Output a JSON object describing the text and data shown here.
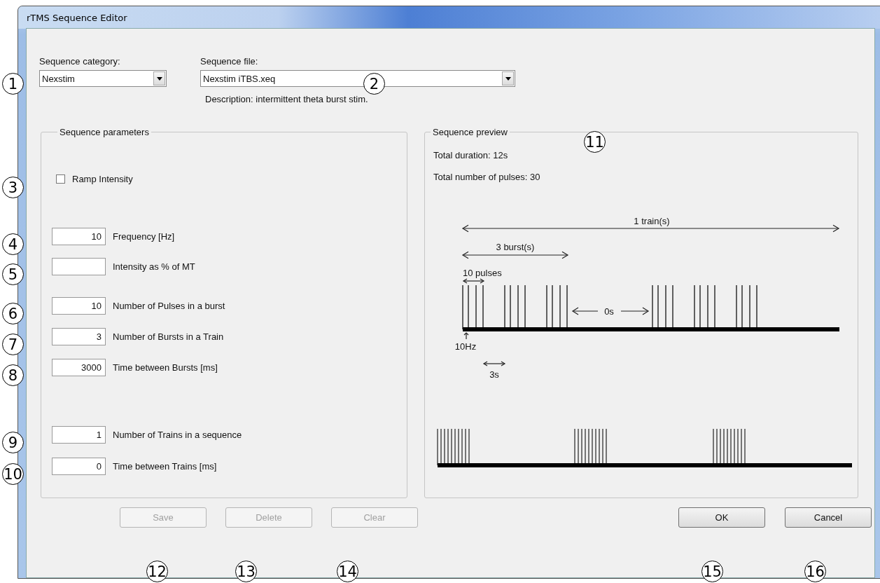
{
  "window": {
    "title": "rTMS Sequence Editor"
  },
  "category": {
    "label": "Sequence category:",
    "value": "Nexstim"
  },
  "file": {
    "label": "Sequence file:",
    "value": "Nexstim iTBS.xeq",
    "description": "Description:  intermittent theta burst stim."
  },
  "parameters": {
    "title": "Sequence parameters",
    "rows": [
      {
        "kind": "checkbox",
        "label": "Ramp Intensity",
        "checked": false
      },
      {
        "kind": "field",
        "value": "10",
        "label": "Frequency [Hz]"
      },
      {
        "kind": "field",
        "label": "Intensity as % of MT"
      },
      {
        "kind": "field",
        "value": "10",
        "label": "Number of Pulses in a burst"
      },
      {
        "kind": "field",
        "value": "3",
        "label": "Number of Bursts in a Train"
      },
      {
        "kind": "field",
        "value": "3000",
        "label": "Time between Bursts [ms]"
      },
      {
        "kind": "field",
        "value": "1",
        "label": "Number of Trains in a sequence"
      },
      {
        "kind": "field",
        "value": "0",
        "label": "Time between Trains [ms]"
      }
    ]
  },
  "preview": {
    "title": "Sequence preview",
    "total_duration": "Total duration:  12s",
    "total_pulses": "Total number of pulses:  30",
    "diagram": {
      "train": "1 train(s)",
      "bursts": "3 burst(s)",
      "pulses": "10 pulses",
      "train_gap": "0s",
      "frequency": "10Hz",
      "burst_gap": "3s"
    }
  },
  "buttons": [
    {
      "label": "Save",
      "disabled": true
    },
    {
      "label": "Delete",
      "disabled": true
    },
    {
      "label": "Clear",
      "disabled": true
    },
    {
      "label": "OK",
      "disabled": false
    },
    {
      "label": "Cancel",
      "disabled": false
    }
  ],
  "callouts": [
    "1",
    "2",
    "3",
    "4",
    "5",
    "6",
    "7",
    "8",
    "9",
    "10",
    "11",
    "12",
    "13",
    "14",
    "15",
    "16"
  ]
}
